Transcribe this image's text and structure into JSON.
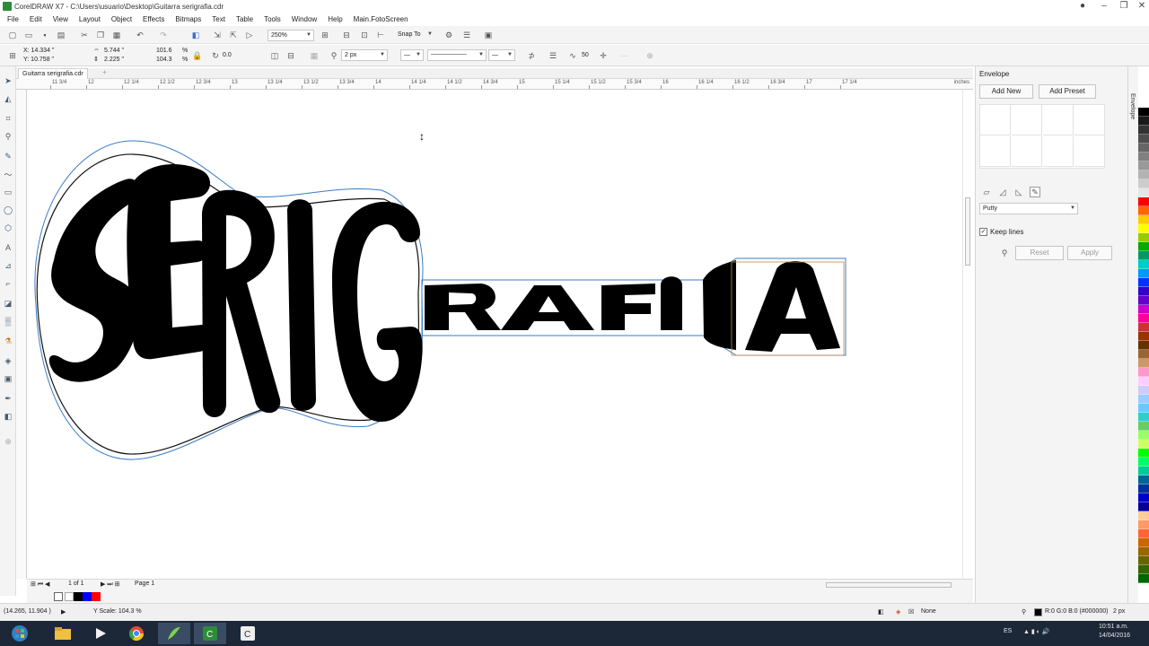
{
  "window": {
    "title": "CorelDRAW X7 - C:\\Users\\usuario\\Desktop\\Guitarra serigrafia.cdr"
  },
  "menu": [
    "File",
    "Edit",
    "View",
    "Layout",
    "Object",
    "Effects",
    "Bitmaps",
    "Text",
    "Table",
    "Tools",
    "Window",
    "Help",
    "Main.FotoScreen"
  ],
  "toolbar": {
    "zoom": "250%",
    "snap_to": "Snap To"
  },
  "property_bar": {
    "x": "X: 14.334 \"",
    "y": "Y: 10.758 \"",
    "width": "5.744 \"",
    "height": "2.225 \"",
    "scale_x": "101.6",
    "scale_y": "104.3",
    "pct": "%",
    "rotation": "0.0",
    "outline_width": "2 px",
    "smooth": "50"
  },
  "document": {
    "tab": "Guitarra serigrafia.cdr",
    "ruler_labels": [
      "11 3/4",
      "12",
      "12 1/4",
      "12 1/2",
      "12 3/4",
      "13",
      "13 1/4",
      "13 1/2",
      "13 3/4",
      "14",
      "14 1/4",
      "14 1/2",
      "14 3/4",
      "15",
      "15 1/4",
      "15 1/2",
      "15 3/4",
      "16",
      "16 1/4",
      "16 1/2",
      "16 3/4",
      "17",
      "17 1/4"
    ],
    "ruler_units": "inches",
    "artwork": {
      "body_text": "SERIG",
      "neck_text": "RAFIA",
      "fill_color": "#000000",
      "envelope_color": "#3a7bc8"
    }
  },
  "page_nav": {
    "count": "1 of 1",
    "page_tab": "Page 1"
  },
  "docker": {
    "title": "Envelope",
    "add_new": "Add New",
    "add_preset": "Add Preset",
    "mode": "Putty",
    "keep_lines_label": "Keep lines",
    "keep_lines_checked": true,
    "reset": "Reset",
    "apply": "Apply",
    "side_tab": "Envelope"
  },
  "status": {
    "coords": "(14.265, 11.904 )",
    "info": "Y Scale: 104.3 %",
    "fill": "None",
    "outline_color": "R:0 G:0 B:0 (#000000)",
    "outline_width": "2 px"
  },
  "taskbar": {
    "lang": "ES",
    "time": "10:51 a.m.",
    "date": "14/04/2016"
  },
  "palette": [
    "#ffffff",
    "#000000",
    "#1a1a1a",
    "#333333",
    "#4d4d4d",
    "#666666",
    "#808080",
    "#999999",
    "#b3b3b3",
    "#cccccc",
    "#e6e6e6",
    "#ff0000",
    "#ff6600",
    "#ffcc00",
    "#ffff00",
    "#99cc00",
    "#00aa00",
    "#009966",
    "#00cccc",
    "#0099ff",
    "#0033ff",
    "#3300cc",
    "#6600cc",
    "#cc00cc",
    "#ff0099",
    "#cc3333",
    "#993300",
    "#663300",
    "#996633",
    "#cc9966",
    "#ff99cc",
    "#ffccff",
    "#ccccff",
    "#99ccff",
    "#66ccff",
    "#33cccc",
    "#66cc66",
    "#99ff66",
    "#ccff66",
    "#00ff00",
    "#00ff66",
    "#00cc99",
    "#006699",
    "#003399",
    "#0000cc",
    "#000099",
    "#ffcc99",
    "#ff9966",
    "#ff6633",
    "#cc6600",
    "#996600",
    "#666600",
    "#336600",
    "#006600"
  ]
}
